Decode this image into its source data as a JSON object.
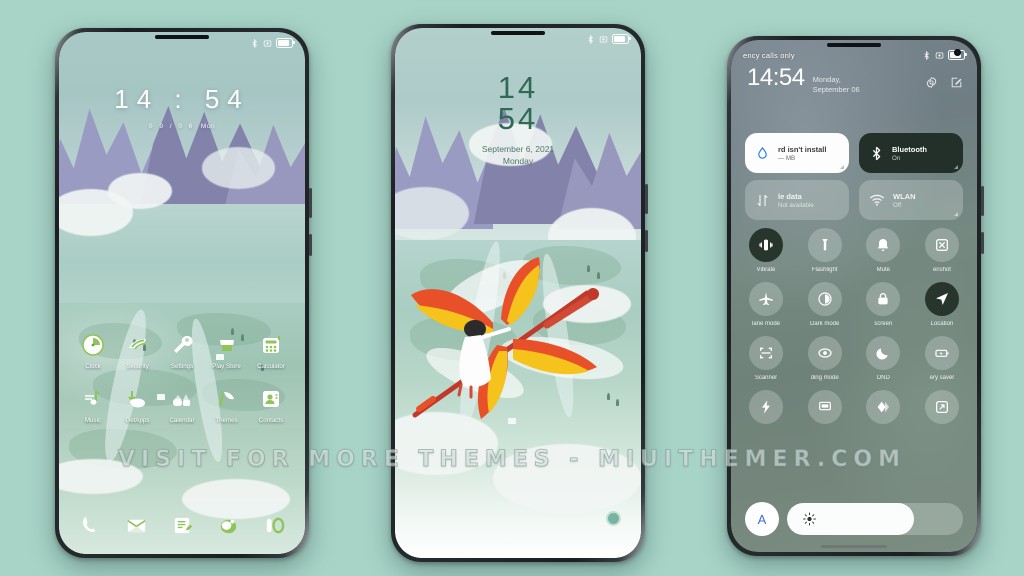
{
  "background_color": "#a8d4c8",
  "watermark": "VISIT FOR MORE THEMES - MIUITHEMER.COM",
  "phone1": {
    "status_bar": {
      "left_text": "",
      "icons": [
        "bluetooth-icon",
        "alarm-icon",
        "battery-icon"
      ]
    },
    "clock_widget": {
      "time": "14 : 54",
      "date": "0 9 / 0 6",
      "weekday": "Mon"
    },
    "apps_row1": [
      {
        "label": "Clock",
        "icon": "clock-icon"
      },
      {
        "label": "Security",
        "icon": "security-icon"
      },
      {
        "label": "Settings",
        "icon": "wrench-icon"
      },
      {
        "label": "Play Store",
        "icon": "play-store-icon"
      },
      {
        "label": "Calculator",
        "icon": "calculator-icon"
      }
    ],
    "apps_row2": [
      {
        "label": "Music",
        "icon": "music-note-icon"
      },
      {
        "label": "GetApps",
        "icon": "getapps-icon"
      },
      {
        "label": "Calendar",
        "icon": "calendar-icon"
      },
      {
        "label": "Themes",
        "icon": "themes-icon"
      },
      {
        "label": "Contacts",
        "icon": "contacts-icon"
      }
    ],
    "dock": [
      {
        "label": "Phone",
        "icon": "phone-icon"
      },
      {
        "label": "Messaging",
        "icon": "envelope-icon"
      },
      {
        "label": "Notes",
        "icon": "notes-icon"
      },
      {
        "label": "Camera",
        "icon": "camera-icon"
      },
      {
        "label": "Browser",
        "icon": "browser-icon"
      }
    ]
  },
  "phone2": {
    "status_bar": {
      "left_text": "",
      "icons": [
        "bluetooth-icon",
        "alarm-icon",
        "battery-icon"
      ]
    },
    "lock_screen": {
      "hour": "14",
      "minute": "54",
      "date": "September 6, 2021",
      "weekday": "Monday"
    },
    "wallpaper_subject": "dragonfly-illustration"
  },
  "phone3": {
    "status_bar": {
      "carrier": "ency calls only",
      "icons": [
        "bluetooth-icon",
        "alarm-icon",
        "battery-icon"
      ]
    },
    "header": {
      "time": "14:54",
      "date": "Monday, September 06",
      "actions": [
        {
          "icon": "gear-icon",
          "label": "Settings"
        },
        {
          "icon": "edit-icon",
          "label": "Edit"
        }
      ]
    },
    "big_tiles": [
      {
        "title": "rd isn't install",
        "subtitle": "— MB",
        "icon": "data-drop-icon",
        "style": "white",
        "state": "off"
      },
      {
        "title": "Bluetooth",
        "subtitle": "On",
        "icon": "bluetooth-icon",
        "style": "dark",
        "state": "on"
      },
      {
        "title": "le data",
        "subtitle": "Not available",
        "icon": "mobile-data-icon",
        "style": "dim",
        "state": "off"
      },
      {
        "title": "WLAN",
        "subtitle": "Off",
        "icon": "wifi-icon",
        "style": "dim",
        "state": "off"
      }
    ],
    "toggles_row1": [
      {
        "label": "Vibrate",
        "icon": "vibrate-icon",
        "state": "on"
      },
      {
        "label": "Flashlight",
        "icon": "flashlight-icon",
        "state": "off"
      },
      {
        "label": "Mute",
        "icon": "bell-icon",
        "state": "off"
      },
      {
        "label": "enshot",
        "icon": "screenshot-icon",
        "state": "off"
      }
    ],
    "toggles_row2": [
      {
        "label": "lane mode",
        "icon": "airplane-icon",
        "state": "off"
      },
      {
        "label": "Dark mode",
        "icon": "dark-mode-icon",
        "state": "off"
      },
      {
        "label": "screen",
        "icon": "lock-icon",
        "state": "off"
      },
      {
        "label": "Location",
        "icon": "location-icon",
        "state": "on"
      }
    ],
    "toggles_row3": [
      {
        "label": "Scanner",
        "icon": "scanner-icon",
        "state": "off"
      },
      {
        "label": "ding mode",
        "icon": "eye-icon",
        "state": "off"
      },
      {
        "label": "DND",
        "icon": "moon-icon",
        "state": "off"
      },
      {
        "label": "ery saver",
        "icon": "battery-saver-icon",
        "state": "off"
      }
    ],
    "toggles_row4": [
      {
        "label": "",
        "icon": "power-icon",
        "state": "off"
      },
      {
        "label": "",
        "icon": "cast-icon",
        "state": "off"
      },
      {
        "label": "",
        "icon": "theme-icon",
        "state": "off"
      },
      {
        "label": "",
        "icon": "screen-cast-icon",
        "state": "off"
      }
    ],
    "brightness": {
      "auto_label": "A",
      "icon": "sun-icon",
      "level": 72
    }
  }
}
